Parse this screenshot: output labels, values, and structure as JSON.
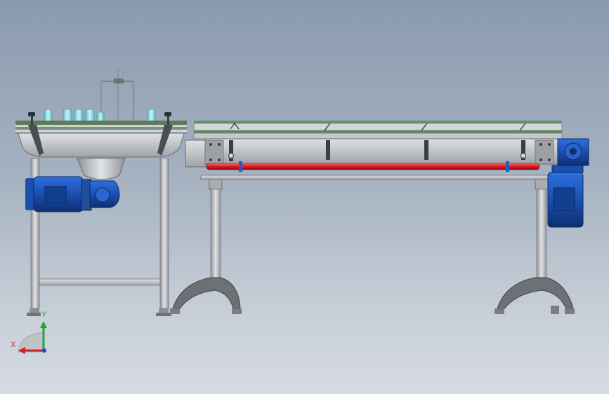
{
  "viewport": {
    "background_top": "#8a9aae",
    "background_bottom": "#d6dbe2"
  },
  "colors": {
    "frame_steel": "#b9bcc0",
    "motor_blue": "#1f5ec8",
    "guide_rail_red": "#e0202a",
    "bottle_cyan": "#7fd6e6",
    "belt_green": "#4e8a4a"
  },
  "triad": {
    "x_label": "X",
    "y_label": "Y",
    "x_color": "#d42020",
    "y_color": "#1fa63a",
    "z_color": "#2a3fd0"
  }
}
